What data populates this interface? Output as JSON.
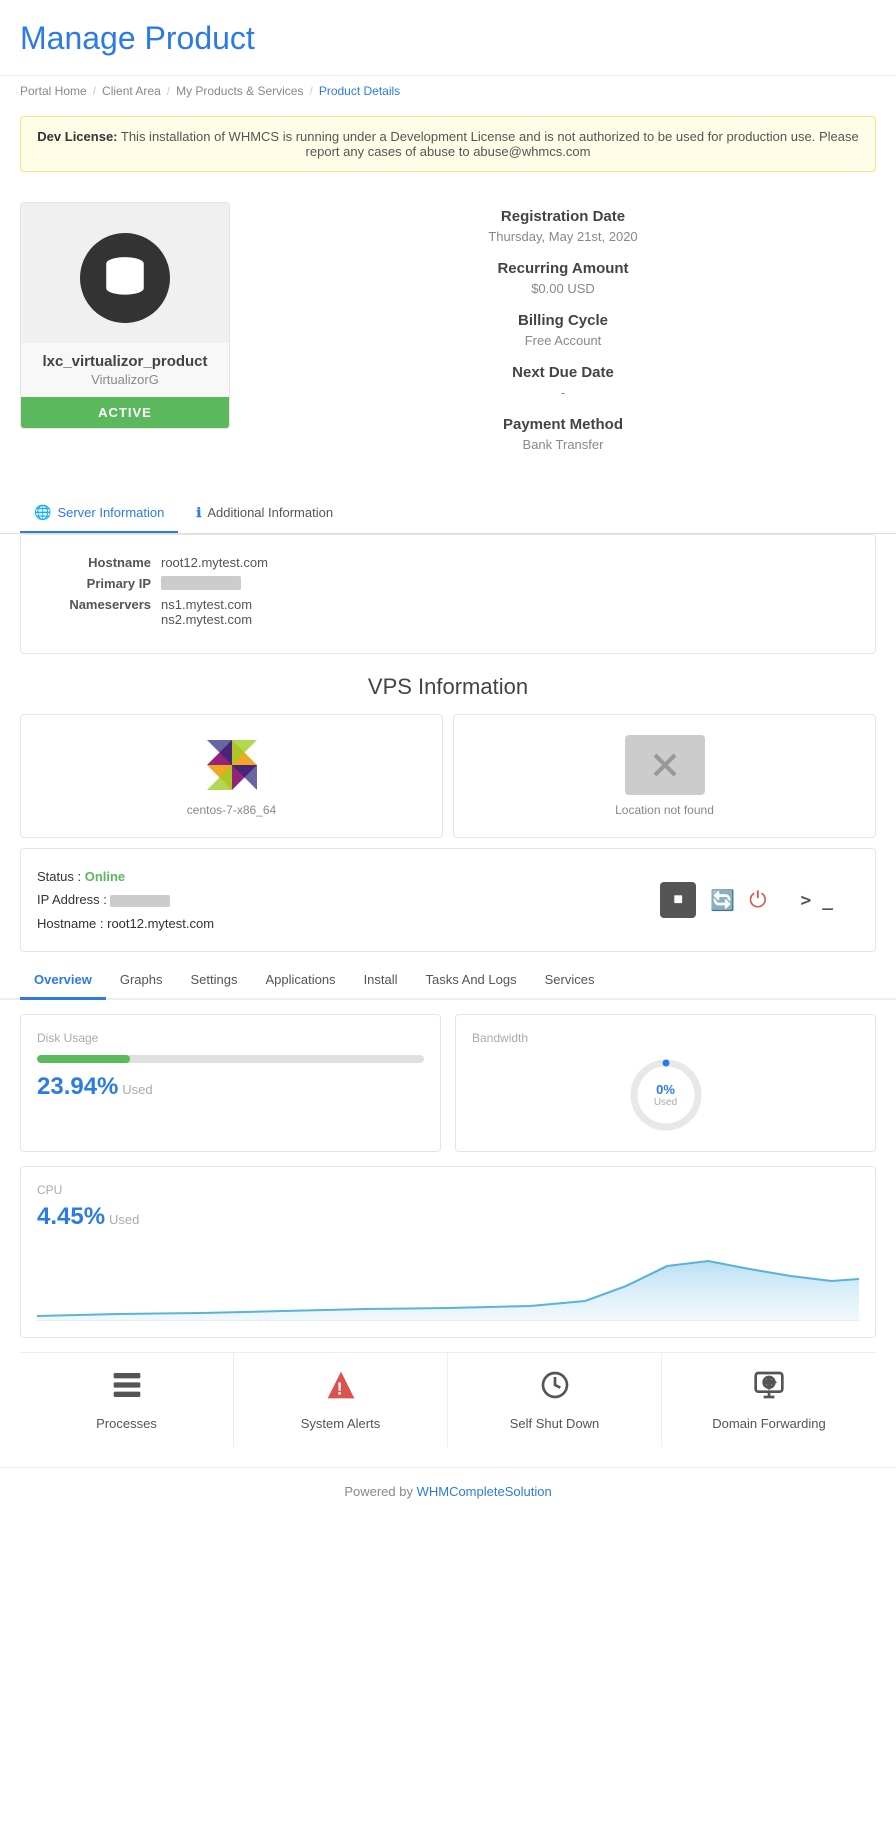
{
  "page": {
    "title": "Manage Product",
    "breadcrumb": [
      "Portal Home",
      "Client Area",
      "My Products & Services",
      "Product Details"
    ]
  },
  "dev_notice": {
    "bold": "Dev License:",
    "text": " This installation of WHMCS is running under a Development License and is not authorized to be used for production use. Please report any cases of abuse to abuse@whmcs.com"
  },
  "product": {
    "name": "lxc_virtualizor_product",
    "sub": "VirtualizorG",
    "status": "ACTIVE",
    "registration_label": "Registration Date",
    "registration_date": "Thursday, May 21st, 2020",
    "recurring_label": "Recurring Amount",
    "recurring_amount": "$0.00 USD",
    "billing_label": "Billing Cycle",
    "billing_value": "Free Account",
    "nextdue_label": "Next Due Date",
    "nextdue_value": "-",
    "payment_label": "Payment Method",
    "payment_value": "Bank Transfer"
  },
  "tabs": {
    "server_info": "Server Information",
    "additional_info": "Additional Information"
  },
  "server": {
    "hostname_label": "Hostname",
    "hostname_value": "root12.mytest.com",
    "primaryip_label": "Primary IP",
    "nameservers_label": "Nameservers",
    "ns1": "ns1.mytest.com",
    "ns2": "ns2.mytest.com"
  },
  "vps": {
    "title": "VPS Information",
    "os": "centos-7-x86_64",
    "location_not_found": "Location not found",
    "status_label": "Status :",
    "status_value": "Online",
    "ip_label": "IP Address :",
    "hostname_label": "Hostname :",
    "hostname_value": "root12.mytest.com"
  },
  "overview_tabs": [
    "Overview",
    "Graphs",
    "Settings",
    "Applications",
    "Install",
    "Tasks And Logs",
    "Services"
  ],
  "stats": {
    "disk_label": "Disk Usage",
    "disk_pct": "23.94%",
    "disk_used": "Used",
    "disk_fill": 23.94,
    "bandwidth_label": "Bandwidth",
    "bandwidth_pct": "0%",
    "bandwidth_used": "Used",
    "cpu_label": "CPU",
    "cpu_pct": "4.45%",
    "cpu_used": "Used"
  },
  "bottom_actions": [
    {
      "label": "Processes",
      "icon": "layers"
    },
    {
      "label": "System Alerts",
      "icon": "alert"
    },
    {
      "label": "Self Shut Down",
      "icon": "clock"
    },
    {
      "label": "Domain Forwarding",
      "icon": "globe"
    }
  ],
  "footer": {
    "text": "Powered by ",
    "link_text": "WHMCompleteSolution",
    "link_href": "#"
  }
}
